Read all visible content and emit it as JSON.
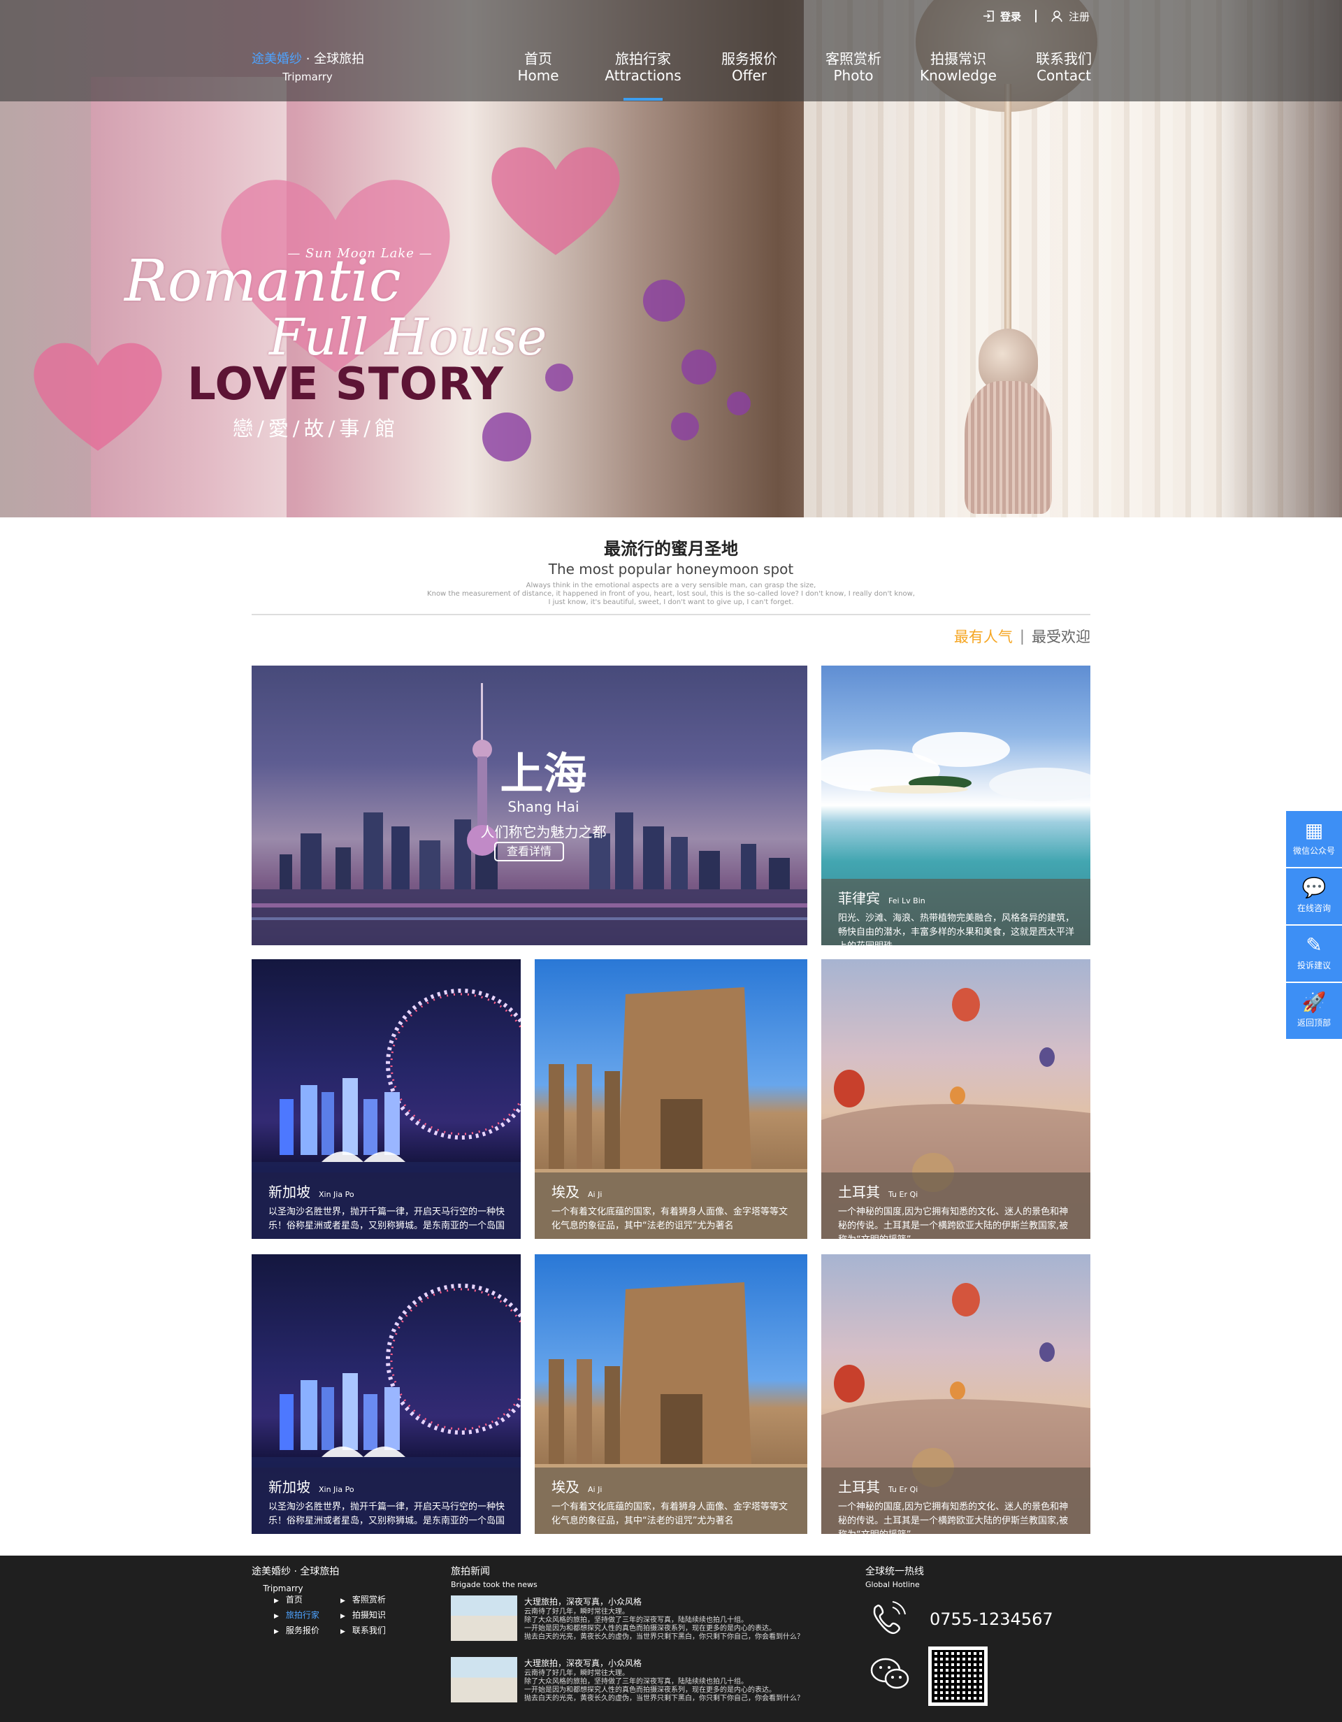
{
  "header": {
    "logo_brand": "途美婚纱",
    "logo_sep": " · ",
    "logo_rest": "全球旅拍",
    "logo_en": "Tripmarry",
    "login": "登录",
    "register": "注册",
    "nav": [
      {
        "cn": "首页",
        "en": "Home"
      },
      {
        "cn": "旅拍行家",
        "en": "Attractions"
      },
      {
        "cn": "服务报价",
        "en": "Offer"
      },
      {
        "cn": "客照赏析",
        "en": "Photo"
      },
      {
        "cn": "拍摄常识",
        "en": "Knowledge"
      },
      {
        "cn": "联系我们",
        "en": "Contact"
      }
    ],
    "active_nav_index": 1
  },
  "hero": {
    "small": "— Sun Moon Lake —",
    "line1": "Romantic",
    "line2": "Full House",
    "line3": "LOVE STORY",
    "cn": "戀/愛/故/事/館"
  },
  "section": {
    "title": "最流行的蜜月圣地",
    "subtitle": "The most popular honeymoon spot",
    "desc1": "Always think in the emotional aspects are a very sensible man, can grasp the size,",
    "desc2": "Know the measurement of distance, it happened in front of you, heart, lost soul, this is the so-called love? I don't know, I really don't know,",
    "desc3": "I just know, it's beautiful, sweet, I don't want to give up, I can't forget.",
    "filter_active": "最有人气",
    "filter_sep": "|",
    "filter_other": "最受欢迎"
  },
  "featured": {
    "cn": "上海",
    "en": "Shang Hai",
    "tagline": "人们称它为魅力之都",
    "button": "查看详情"
  },
  "tiles": [
    {
      "cn": "菲律宾",
      "en": "Fei Lv Bin",
      "desc": "阳光、沙滩、海浪、热带植物完美融合，风格各异的建筑，畅快自由的潜水，丰富多样的水果和美食，这就是西太平洋上的花园明珠"
    },
    {
      "cn": "新加坡",
      "en": "Xin Jia Po",
      "desc": "以圣淘沙名胜世界，抛开千篇一律，开启天马行空的一种快乐！俗称星洲或者星岛，又别称狮城。是东南亚的一个岛国"
    },
    {
      "cn": "埃及",
      "en": "Ai Ji",
      "desc": "一个有着文化底蕴的国家，有着狮身人面像、金字塔等等文化气息的象征品，其中“法老的诅咒”尤为著名"
    },
    {
      "cn": "土耳其",
      "en": "Tu Er Qi",
      "desc": "一个神秘的国度,因为它拥有知悉的文化、迷人的景色和神秘的传说。土耳其是一个横跨欧亚大陆的伊斯兰教国家,被称为“文明的摇篮”。"
    },
    {
      "cn": "新加坡",
      "en": "Xin Jia Po",
      "desc": "以圣淘沙名胜世界，抛开千篇一律，开启天马行空的一种快乐！俗称星洲或者星岛，又别称狮城。是东南亚的一个岛国"
    },
    {
      "cn": "埃及",
      "en": "Ai Ji",
      "desc": "一个有着文化底蕴的国家，有着狮身人面像、金字塔等等文化气息的象征品，其中“法老的诅咒”尤为著名"
    },
    {
      "cn": "土耳其",
      "en": "Tu Er Qi",
      "desc": "一个神秘的国度,因为它拥有知悉的文化、迷人的景色和神秘的传说。土耳其是一个横跨欧亚大陆的伊斯兰教国家,被称为“文明的摇篮”。"
    }
  ],
  "sidebar": [
    {
      "label": "微信公众号",
      "icon": "qr-code-icon"
    },
    {
      "label": "在线咨询",
      "icon": "chat-icon"
    },
    {
      "label": "投诉建议",
      "icon": "edit-icon"
    },
    {
      "label": "返回顶部",
      "icon": "rocket-icon"
    }
  ],
  "footer": {
    "logo": "途美婚纱 · 全球旅拍",
    "logo_en": "Tripmarry",
    "links": [
      "首页",
      "旅拍行家",
      "服务报价",
      "客照赏析",
      "拍摄知识",
      "联系我们"
    ],
    "active_link_index": 1,
    "news_title": "旅拍新闻",
    "news_sub": "Brigade took the news",
    "news": [
      {
        "title": "大理旅拍，深夜写真，小众风格",
        "body": "云南待了好几年，瞬时常往大理。\n除了大众风格的旅拍，坚持做了三年的深夜写真，陆陆续续也拍几十组。\n一开始是因为和都想探究人性的真色而拍摄深夜系列，现在更多的是内心的表达。\n抛去白天的光亮，黄夜长久的虚伪，当世界只剩下黑白，你只剩下你自己，你会看到什么？"
      },
      {
        "title": "大理旅拍，深夜写真，小众风格",
        "body": "云南待了好几年，瞬时常往大理。\n除了大众风格的旅拍，坚持做了三年的深夜写真，陆陆续续也拍几十组。\n一开始是因为和都想探究人性的真色而拍摄深夜系列，现在更多的是内心的表达。\n抛去白天的光亮，黄夜长久的虚伪，当世界只剩下黑白，你只剩下你自己，你会看到什么？"
      }
    ],
    "hotline_title": "全球统一热线",
    "hotline_sub": "Global Hotline",
    "phone": "0755-1234567"
  },
  "colors": {
    "accent": "#3d8ff5",
    "highlight": "#f5a623",
    "footer_bg": "#1f1f1f"
  }
}
